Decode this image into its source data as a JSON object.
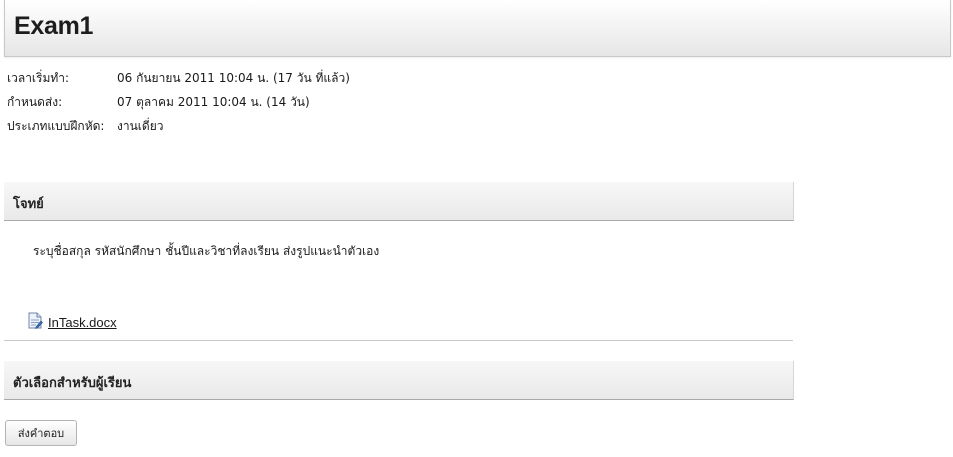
{
  "page": {
    "title": "Exam1"
  },
  "details": {
    "start_label": "เวลาเริ่มทำ:",
    "start_value": "06 กันยายน 2011 10:04 น. (17 วัน ที่แล้ว)",
    "due_label": "กำหนดส่ง:",
    "due_value": "07 ตุลาคม 2011 10:04 น. (14 วัน)",
    "type_label": "ประเภทแบบฝึกหัด:",
    "type_value": "งานเดี่ยว"
  },
  "task": {
    "heading": "โจทย์",
    "description": "ระบุชื่อสกุล รหัสนักศึกษา ชั้นปีและวิชาที่ลงเรียน  ส่งรูปแนะนำตัวเอง",
    "attachment_name": "InTask.docx",
    "attachment_icon": "document-icon"
  },
  "options": {
    "heading": "ตัวเลือกสำหรับผู้เรียน",
    "submit_label": "ส่งคำตอบ"
  }
}
